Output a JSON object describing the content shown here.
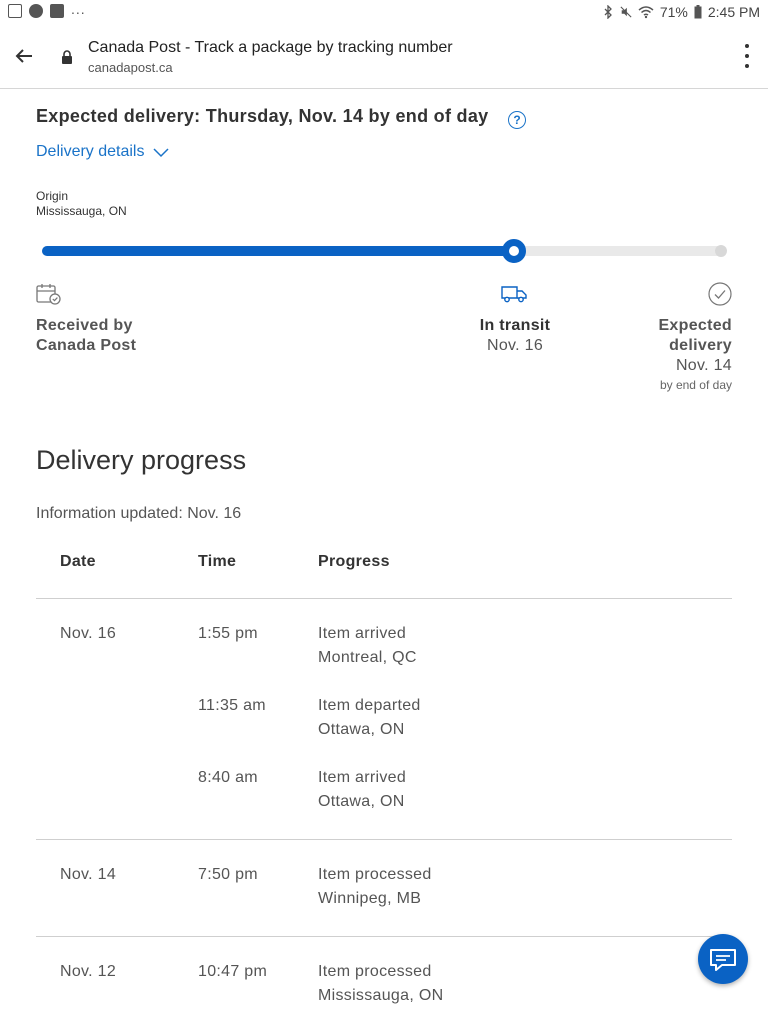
{
  "status_bar": {
    "left_overflow": "...",
    "battery": "71%",
    "time": "2:45 PM"
  },
  "browser": {
    "page_title": "Canada Post - Track a package by tracking number",
    "url": "canadapost.ca"
  },
  "header": {
    "expected_delivery": "Expected delivery: Thursday, Nov. 14 by end of day",
    "help_glyph": "?",
    "delivery_details": "Delivery details"
  },
  "origin": {
    "label": "Origin",
    "value": "Mississauga, ON"
  },
  "tracker": {
    "progress_fraction": 0.69,
    "stages": [
      {
        "name_line1": "Received by",
        "name_line2": "Canada Post",
        "icon": "package-calendar-icon"
      },
      {
        "name": "In transit",
        "date": "Nov. 16",
        "icon": "truck-icon"
      },
      {
        "name_line1": "Expected",
        "name_line2": "delivery",
        "date": "Nov. 14",
        "sub": "by end of day",
        "icon": "check-circle-icon"
      }
    ]
  },
  "progress": {
    "heading": "Delivery progress",
    "updated": "Information updated: Nov. 16",
    "columns": [
      "Date",
      "Time",
      "Progress"
    ],
    "rows": [
      {
        "date": "Nov. 16",
        "time": "1:55 pm",
        "event": "Item arrived",
        "location": "Montreal, QC"
      },
      {
        "date": "",
        "time": "11:35 am",
        "event": "Item departed",
        "location": "Ottawa, ON"
      },
      {
        "date": "",
        "time": "8:40 am",
        "event": "Item arrived",
        "location": "Ottawa, ON"
      },
      {
        "date": "Nov. 14",
        "time": "7:50 pm",
        "event": "Item processed",
        "location": "Winnipeg, MB"
      },
      {
        "date": "Nov. 12",
        "time": "10:47 pm",
        "event": "Item processed",
        "location": "Mississauga, ON"
      }
    ]
  },
  "colors": {
    "brand_blue": "#0a62c4",
    "link_blue": "#1a73c8"
  }
}
